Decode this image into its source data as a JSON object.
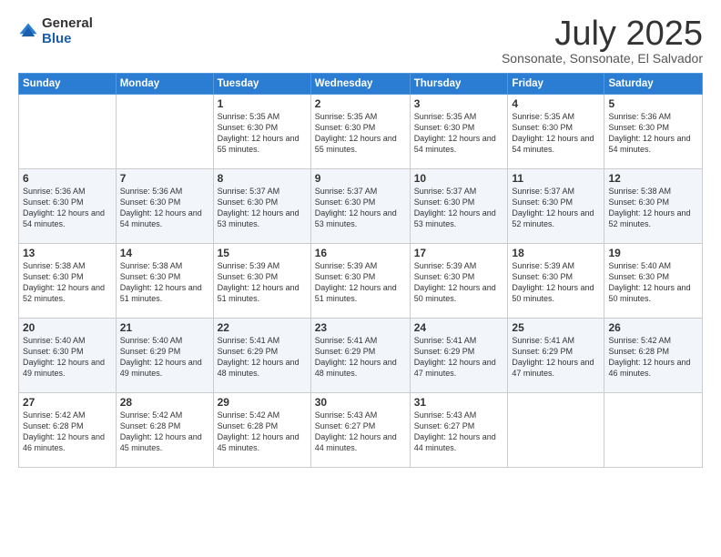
{
  "logo": {
    "general": "General",
    "blue": "Blue"
  },
  "header": {
    "month": "July 2025",
    "location": "Sonsonate, Sonsonate, El Salvador"
  },
  "weekdays": [
    "Sunday",
    "Monday",
    "Tuesday",
    "Wednesday",
    "Thursday",
    "Friday",
    "Saturday"
  ],
  "weeks": [
    [
      {
        "day": "",
        "detail": ""
      },
      {
        "day": "",
        "detail": ""
      },
      {
        "day": "1",
        "detail": "Sunrise: 5:35 AM\nSunset: 6:30 PM\nDaylight: 12 hours and 55 minutes."
      },
      {
        "day": "2",
        "detail": "Sunrise: 5:35 AM\nSunset: 6:30 PM\nDaylight: 12 hours and 55 minutes."
      },
      {
        "day": "3",
        "detail": "Sunrise: 5:35 AM\nSunset: 6:30 PM\nDaylight: 12 hours and 54 minutes."
      },
      {
        "day": "4",
        "detail": "Sunrise: 5:35 AM\nSunset: 6:30 PM\nDaylight: 12 hours and 54 minutes."
      },
      {
        "day": "5",
        "detail": "Sunrise: 5:36 AM\nSunset: 6:30 PM\nDaylight: 12 hours and 54 minutes."
      }
    ],
    [
      {
        "day": "6",
        "detail": "Sunrise: 5:36 AM\nSunset: 6:30 PM\nDaylight: 12 hours and 54 minutes."
      },
      {
        "day": "7",
        "detail": "Sunrise: 5:36 AM\nSunset: 6:30 PM\nDaylight: 12 hours and 54 minutes."
      },
      {
        "day": "8",
        "detail": "Sunrise: 5:37 AM\nSunset: 6:30 PM\nDaylight: 12 hours and 53 minutes."
      },
      {
        "day": "9",
        "detail": "Sunrise: 5:37 AM\nSunset: 6:30 PM\nDaylight: 12 hours and 53 minutes."
      },
      {
        "day": "10",
        "detail": "Sunrise: 5:37 AM\nSunset: 6:30 PM\nDaylight: 12 hours and 53 minutes."
      },
      {
        "day": "11",
        "detail": "Sunrise: 5:37 AM\nSunset: 6:30 PM\nDaylight: 12 hours and 52 minutes."
      },
      {
        "day": "12",
        "detail": "Sunrise: 5:38 AM\nSunset: 6:30 PM\nDaylight: 12 hours and 52 minutes."
      }
    ],
    [
      {
        "day": "13",
        "detail": "Sunrise: 5:38 AM\nSunset: 6:30 PM\nDaylight: 12 hours and 52 minutes."
      },
      {
        "day": "14",
        "detail": "Sunrise: 5:38 AM\nSunset: 6:30 PM\nDaylight: 12 hours and 51 minutes."
      },
      {
        "day": "15",
        "detail": "Sunrise: 5:39 AM\nSunset: 6:30 PM\nDaylight: 12 hours and 51 minutes."
      },
      {
        "day": "16",
        "detail": "Sunrise: 5:39 AM\nSunset: 6:30 PM\nDaylight: 12 hours and 51 minutes."
      },
      {
        "day": "17",
        "detail": "Sunrise: 5:39 AM\nSunset: 6:30 PM\nDaylight: 12 hours and 50 minutes."
      },
      {
        "day": "18",
        "detail": "Sunrise: 5:39 AM\nSunset: 6:30 PM\nDaylight: 12 hours and 50 minutes."
      },
      {
        "day": "19",
        "detail": "Sunrise: 5:40 AM\nSunset: 6:30 PM\nDaylight: 12 hours and 50 minutes."
      }
    ],
    [
      {
        "day": "20",
        "detail": "Sunrise: 5:40 AM\nSunset: 6:30 PM\nDaylight: 12 hours and 49 minutes."
      },
      {
        "day": "21",
        "detail": "Sunrise: 5:40 AM\nSunset: 6:29 PM\nDaylight: 12 hours and 49 minutes."
      },
      {
        "day": "22",
        "detail": "Sunrise: 5:41 AM\nSunset: 6:29 PM\nDaylight: 12 hours and 48 minutes."
      },
      {
        "day": "23",
        "detail": "Sunrise: 5:41 AM\nSunset: 6:29 PM\nDaylight: 12 hours and 48 minutes."
      },
      {
        "day": "24",
        "detail": "Sunrise: 5:41 AM\nSunset: 6:29 PM\nDaylight: 12 hours and 47 minutes."
      },
      {
        "day": "25",
        "detail": "Sunrise: 5:41 AM\nSunset: 6:29 PM\nDaylight: 12 hours and 47 minutes."
      },
      {
        "day": "26",
        "detail": "Sunrise: 5:42 AM\nSunset: 6:28 PM\nDaylight: 12 hours and 46 minutes."
      }
    ],
    [
      {
        "day": "27",
        "detail": "Sunrise: 5:42 AM\nSunset: 6:28 PM\nDaylight: 12 hours and 46 minutes."
      },
      {
        "day": "28",
        "detail": "Sunrise: 5:42 AM\nSunset: 6:28 PM\nDaylight: 12 hours and 45 minutes."
      },
      {
        "day": "29",
        "detail": "Sunrise: 5:42 AM\nSunset: 6:28 PM\nDaylight: 12 hours and 45 minutes."
      },
      {
        "day": "30",
        "detail": "Sunrise: 5:43 AM\nSunset: 6:27 PM\nDaylight: 12 hours and 44 minutes."
      },
      {
        "day": "31",
        "detail": "Sunrise: 5:43 AM\nSunset: 6:27 PM\nDaylight: 12 hours and 44 minutes."
      },
      {
        "day": "",
        "detail": ""
      },
      {
        "day": "",
        "detail": ""
      }
    ]
  ]
}
